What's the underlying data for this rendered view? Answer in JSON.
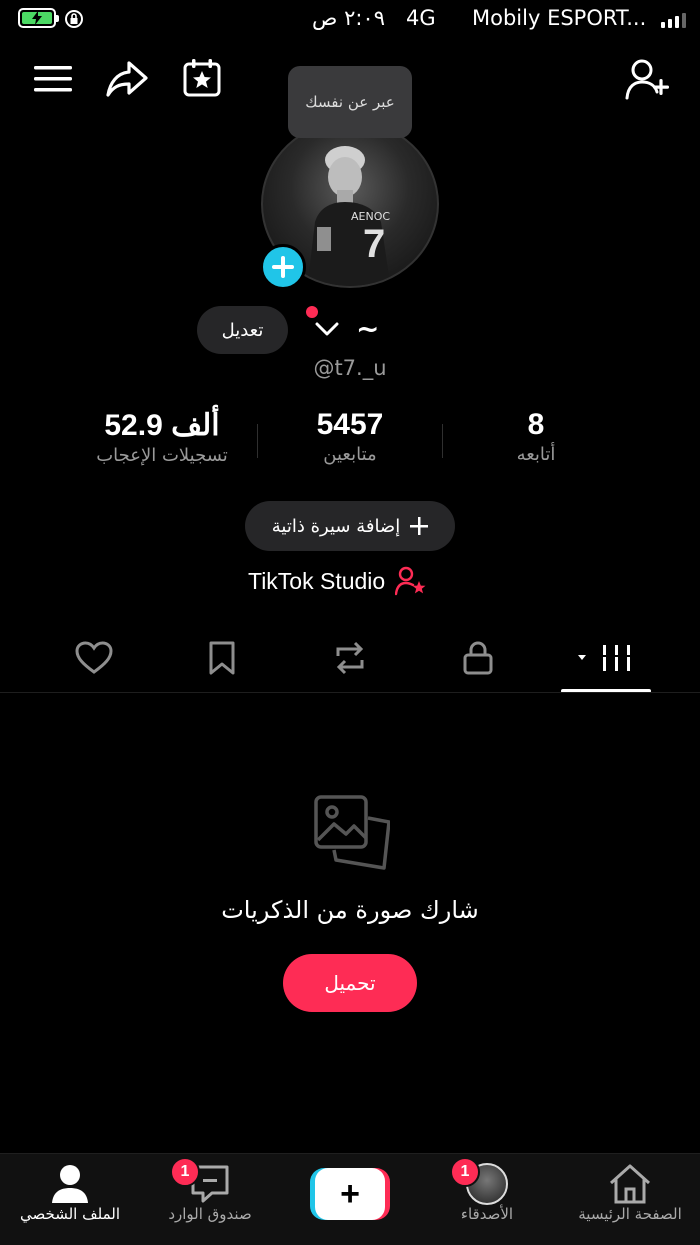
{
  "status_bar": {
    "time": "٢:٠٩ ص",
    "network": "4G",
    "carrier": "Mobily ESPORT..."
  },
  "profile": {
    "tooltip": "عبر عن نفسك",
    "display_name": "~",
    "username": "@t7._u",
    "edit_label": "تعديل",
    "add_bio_label": "إضافة سيرة ذاتية",
    "studio_label": "TikTok Studio"
  },
  "stats": [
    {
      "value": "8",
      "label": "أتابعه"
    },
    {
      "value": "5457",
      "label": "متابعين"
    },
    {
      "value": "52.9 ألف",
      "label": "تسجيلات الإعجاب"
    }
  ],
  "empty_state": {
    "title": "شارك صورة من الذكريات",
    "button_label": "تحميل"
  },
  "bottom_nav": {
    "home": "الصفحة الرئيسية",
    "friends": "الأصدقاء",
    "friends_badge": "1",
    "add": "+",
    "inbox": "صندوق الوارد",
    "inbox_badge": "1",
    "profile": "الملف الشخصي"
  },
  "colors": {
    "accent": "#fe2c55",
    "cyan": "#20c5e8",
    "battery": "#4cd964"
  }
}
